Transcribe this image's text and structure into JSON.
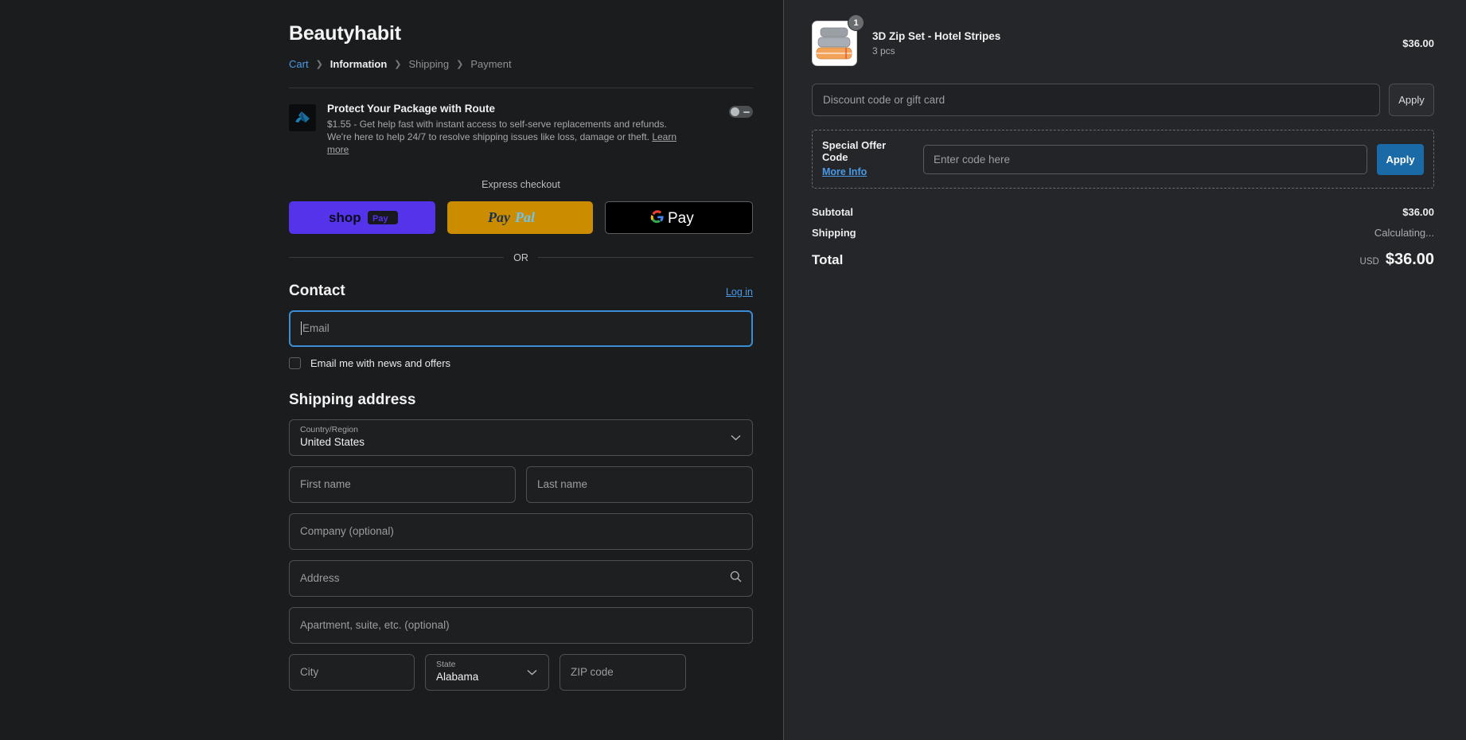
{
  "header": {
    "shop_name": "Beautyhabit",
    "breadcrumb": [
      {
        "label": "Cart",
        "state": "link"
      },
      {
        "label": "Information",
        "state": "current"
      },
      {
        "label": "Shipping",
        "state": "muted"
      },
      {
        "label": "Payment",
        "state": "muted"
      }
    ]
  },
  "route": {
    "title": "Protect Your Package with Route",
    "description": "$1.55 - Get help fast with instant access to self-serve replacements and refunds. We're here to help 24/7 to resolve shipping issues like loss, damage or theft.",
    "learn_more": "Learn more",
    "toggle_state": "off"
  },
  "express": {
    "label": "Express checkout",
    "buttons": [
      {
        "name": "shop-pay",
        "label": "shop Pay",
        "color": "#5433eb"
      },
      {
        "name": "paypal",
        "label": "PayPal",
        "color": "#cc8c00"
      },
      {
        "name": "google-pay",
        "label": "G Pay",
        "color": "#000000"
      }
    ],
    "divider_text": "OR"
  },
  "contact": {
    "title": "Contact",
    "login_label": "Log in",
    "email_placeholder": "Email",
    "email_value": "",
    "newsletter_label": "Email me with news and offers",
    "newsletter_checked": false
  },
  "shipping": {
    "title": "Shipping address",
    "country_label": "Country/Region",
    "country_value": "United States",
    "first_name_placeholder": "First name",
    "last_name_placeholder": "Last name",
    "company_placeholder": "Company (optional)",
    "address_placeholder": "Address",
    "apartment_placeholder": "Apartment, suite, etc. (optional)",
    "city_placeholder": "City",
    "state_label": "State",
    "state_value": "Alabama",
    "zip_placeholder": "ZIP code"
  },
  "summary": {
    "product": {
      "name": "3D Zip Set - Hotel Stripes",
      "variant": "3 pcs",
      "price": "$36.00",
      "quantity": "1"
    },
    "discount_placeholder": "Discount code or gift card",
    "discount_apply_label": "Apply",
    "special_offer": {
      "title": "Special Offer Code",
      "more_info_label": "More Info",
      "input_placeholder": "Enter code here",
      "apply_label": "Apply",
      "apply_color": "#1a6aa8"
    },
    "totals": [
      {
        "label": "Subtotal",
        "value": "$36.00",
        "muted": false
      },
      {
        "label": "Shipping",
        "value": "Calculating...",
        "muted": true
      }
    ],
    "grand_total": {
      "label": "Total",
      "currency": "USD",
      "value": "$36.00"
    }
  }
}
